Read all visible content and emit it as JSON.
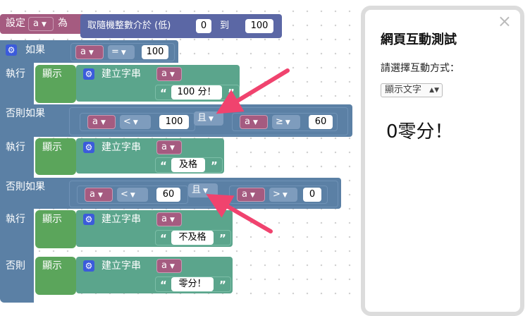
{
  "workspace": {
    "set_block": {
      "label": "設定",
      "var": "a",
      "as": "為"
    },
    "random_block": {
      "label": "取隨機整數介於 (低)",
      "low": "0",
      "to": "到",
      "high": "100"
    },
    "if_block": {
      "if_label": "如果",
      "var": "a",
      "op": "=",
      "value": "100"
    },
    "do1": {
      "label": "執行",
      "show": "顯示",
      "join": "建立字串",
      "var": "a",
      "text": "100 分！"
    },
    "elseif1": {
      "label": "否則如果",
      "left": {
        "var": "a",
        "op": "<",
        "value": "100"
      },
      "and": "且",
      "right": {
        "var": "a",
        "op": "≥",
        "value": "60"
      }
    },
    "do2": {
      "label": "執行",
      "show": "顯示",
      "join": "建立字串",
      "var": "a",
      "text": "及格"
    },
    "elseif2": {
      "label": "否則如果",
      "left": {
        "var": "a",
        "op": "<",
        "value": "60"
      },
      "and": "且",
      "right": {
        "var": "a",
        "op": ">",
        "value": "0"
      }
    },
    "do3": {
      "label": "執行",
      "show": "顯示",
      "join": "建立字串",
      "var": "a",
      "text": "不及格"
    },
    "else": {
      "label": "否則",
      "show": "顯示",
      "join": "建立字串",
      "var": "a",
      "text": "零分！"
    },
    "quote_open": "“",
    "quote_close": "”",
    "gear_icon": "gear-icon",
    "arrow_color": "#f0436e"
  },
  "panel": {
    "title": "網頁互動測試",
    "prompt": "請選擇互動方式：",
    "select_value": "顯示文字",
    "output": "0零分！",
    "close": "×"
  },
  "colors": {
    "variable": "#a55b80",
    "logic": "#5b80a5",
    "math": "#5b67a5",
    "text": "#5ba58c",
    "output": "#5ba55b"
  }
}
